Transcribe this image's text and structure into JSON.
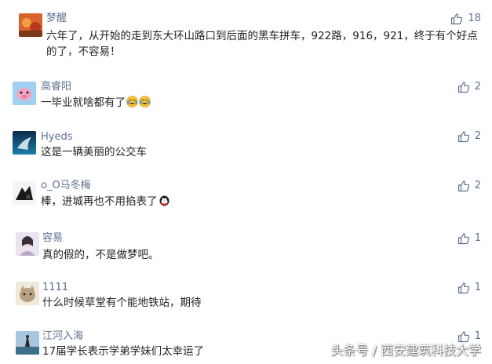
{
  "comments": [
    {
      "name": "梦醒",
      "likes": "18",
      "text": "六年了，从开始的走到东大环山路口到后面的黑车拼车，922路，916，921，终于有个好点的了，不容易！"
    },
    {
      "name": "高睿阳",
      "likes": "2",
      "text": "一毕业就啥都有了"
    },
    {
      "name": "Hyeds",
      "likes": "2",
      "text": "这是一辆美丽的公交车"
    },
    {
      "name": "o_O马冬梅",
      "likes": "2",
      "text": "棒，进城再也不用掐表了"
    },
    {
      "name": "容易",
      "likes": "1",
      "text": "真的假的，不是做梦吧。"
    },
    {
      "name": "1111",
      "likes": "1",
      "text": "什么时候草堂有个能地铁站，期待"
    },
    {
      "name": "江河入海",
      "likes": "1",
      "text": "17届学长表示学弟学妹们太幸运了"
    }
  ],
  "icons": {
    "like": "thumbs-up-icon",
    "emoji_cry": "crying-laughing-emoji-icon",
    "emoji_penguin": "penguin-emoji-icon"
  },
  "colors": {
    "name": "#5d6f8f",
    "text": "#222222",
    "like": "#5d6f8f"
  },
  "watermark": "头条号 / 西安建筑科技大学"
}
